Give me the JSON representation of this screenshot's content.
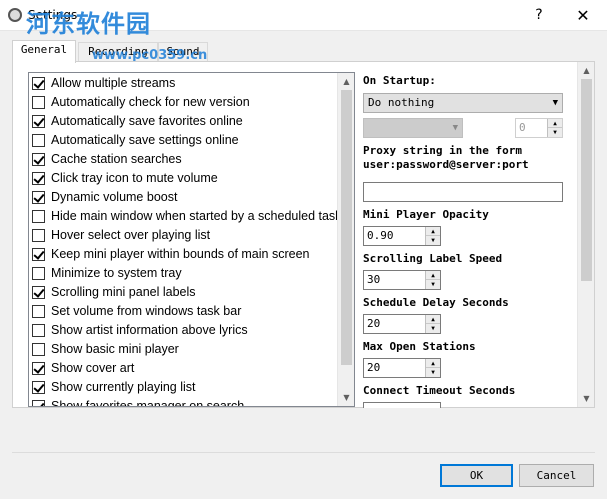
{
  "window": {
    "title": "Settings",
    "help_glyph": "?",
    "close_glyph": "✕"
  },
  "watermark": {
    "text": "河东软件园",
    "url": "www.pc0359.cn"
  },
  "tabs": [
    {
      "label": "General",
      "active": true
    },
    {
      "label": "Recording",
      "active": false
    },
    {
      "label": "Sound",
      "active": false
    }
  ],
  "options": [
    {
      "label": "Allow multiple streams",
      "checked": true
    },
    {
      "label": "Automatically check for new version",
      "checked": false
    },
    {
      "label": "Automatically save favorites online",
      "checked": true
    },
    {
      "label": "Automatically save settings online",
      "checked": false
    },
    {
      "label": "Cache station searches",
      "checked": true
    },
    {
      "label": "Click tray icon to mute volume",
      "checked": true
    },
    {
      "label": "Dynamic volume boost",
      "checked": true
    },
    {
      "label": "Hide main window when started by a scheduled task",
      "checked": false
    },
    {
      "label": "Hover select over playing list",
      "checked": false
    },
    {
      "label": "Keep mini player within bounds of main screen",
      "checked": true
    },
    {
      "label": "Minimize to system tray",
      "checked": false
    },
    {
      "label": "Scrolling mini panel labels",
      "checked": true
    },
    {
      "label": "Set volume from windows task bar",
      "checked": false
    },
    {
      "label": "Show artist information above lyrics",
      "checked": false
    },
    {
      "label": "Show basic mini player",
      "checked": false
    },
    {
      "label": "Show cover art",
      "checked": true
    },
    {
      "label": "Show currently playing list",
      "checked": true
    },
    {
      "label": "Show favorites manager on search",
      "checked": true
    }
  ],
  "list_scroll": {
    "position": 0.0,
    "visible_fraction": 0.92
  },
  "right": {
    "startup_label": "On Startup:",
    "startup_value": "Do nothing",
    "disabled_combo_value": "",
    "disabled_spin_value": "0",
    "proxy_label_1": "Proxy string in the form",
    "proxy_label_2": "user:password@server:port",
    "proxy_value": "",
    "opacity_label": "Mini Player Opacity",
    "opacity_value": "0.90",
    "scroll_speed_label": "Scrolling Label Speed",
    "scroll_speed_value": "30",
    "schedule_delay_label": "Schedule Delay Seconds",
    "schedule_delay_value": "20",
    "max_stations_label": "Max Open Stations",
    "max_stations_value": "20",
    "connect_timeout_label": "Connect Timeout Seconds",
    "connect_timeout_value": ""
  },
  "panel_scroll": {
    "position": 0.0,
    "visible_fraction": 0.65
  },
  "buttons": {
    "ok": "OK",
    "cancel": "Cancel"
  },
  "glyphs": {
    "arrow_down": "▼",
    "arrow_up": "▲",
    "spin_up": "▲",
    "spin_down": "▼"
  }
}
